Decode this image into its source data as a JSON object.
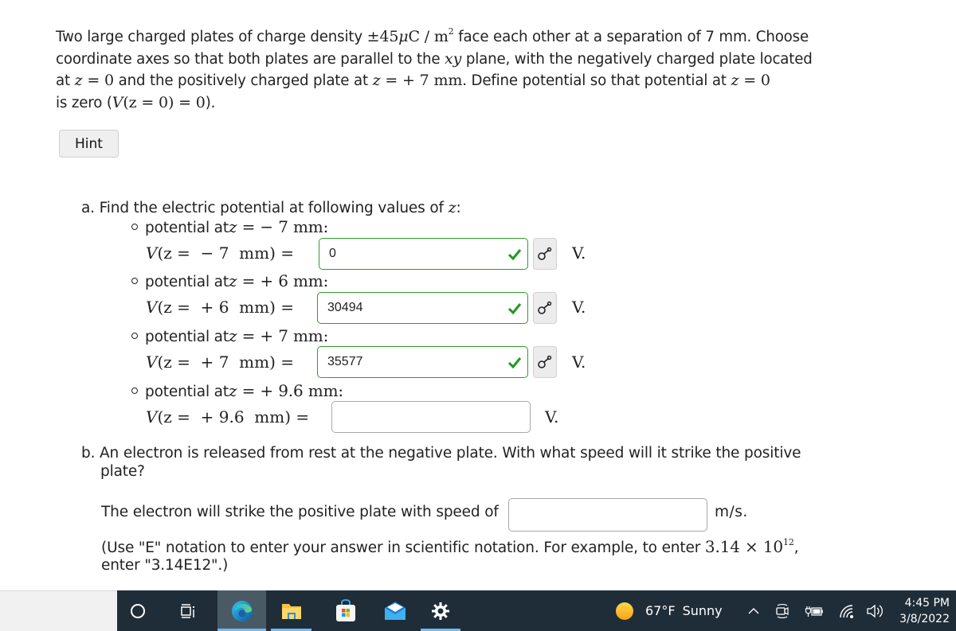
{
  "problem": {
    "line1_a": "Two large charged plates of charge density ",
    "charge_density": "±45",
    "mu": "μ",
    "unit_C": "C / m",
    "sup2": "2",
    "line1_b": " face each other at a separation of 7 mm. Choose",
    "line2_a": "coordinate axes so that both plates are parallel to the ",
    "xy": "xy",
    "line2_b": " plane, with the negatively charged plate located",
    "line3_a": "at ",
    "z": "z",
    "eq_zero": " = 0",
    "line3_b": " and the positively charged plate at ",
    "eq_plus7": " =  + 7  mm",
    "line3_c": ". Define potential so that potential at ",
    "line4_a": "is zero (",
    "V_expr": "V",
    "v0_expr": "(z = 0) = 0",
    "line4_b": ")."
  },
  "hint_button": {
    "label": "Hint"
  },
  "part_a": {
    "title": "a. Find the electric potential at following values of ",
    "title_var": "z",
    "title_end": ":",
    "items": [
      {
        "bullet_text": "potential at ",
        "bullet_math": " =  − 7  mm:",
        "eq_lhs": "(z =  − 7  mm) = ",
        "value": "0",
        "status": "correct",
        "unit": "V."
      },
      {
        "bullet_text": "potential at ",
        "bullet_math": " =  + 6  mm:",
        "eq_lhs": "(z =  + 6  mm) = ",
        "value": "30494",
        "status": "correct",
        "unit": "V."
      },
      {
        "bullet_text": "potential at ",
        "bullet_math": " =  + 7  mm:",
        "eq_lhs": "(z =  + 7  mm) = ",
        "value": "35577",
        "status": "correct",
        "unit": "V."
      },
      {
        "bullet_text": "potential at ",
        "bullet_math": " =  + 9.6  mm:",
        "eq_lhs": "(z =  + 9.6  mm) = ",
        "value": "",
        "status": "blank",
        "unit": "V."
      }
    ]
  },
  "part_b": {
    "question_line1": "b. An electron is released from rest at the negative plate. With what speed will it strike the positive",
    "question_line2": "plate?",
    "speed_prompt": "The electron will strike the positive plate with speed of",
    "speed_value": "",
    "speed_unit": "m/s.",
    "note_a": "(Use \"E\" notation to enter your answer in scientific notation. For example, to enter ",
    "note_math": "3.14 × 10",
    "note_exp": "12",
    "note_b": ",",
    "note_line2": "enter \"3.14E12\".)"
  },
  "taskbar": {
    "apps": [
      {
        "name": "cortana",
        "icon": "circle-icon"
      },
      {
        "name": "task-view",
        "icon": "task-view-icon"
      },
      {
        "name": "edge",
        "icon": "edge-icon",
        "active": true,
        "running": true
      },
      {
        "name": "file-explorer",
        "icon": "folder-icon",
        "running": true
      },
      {
        "name": "microsoft-store",
        "icon": "store-icon"
      },
      {
        "name": "mail",
        "icon": "mail-icon"
      },
      {
        "name": "settings",
        "icon": "gear-icon",
        "running": true
      }
    ],
    "weather": {
      "temp": "67°F",
      "condition": "Sunny",
      "icon": "sun-icon"
    },
    "time": "4:45 PM",
    "date": "3/8/2022"
  },
  "colors": {
    "correct_border": "#2c9e2c",
    "taskbar_bg": "#1f2d38",
    "running_indicator": "#76b9ed"
  }
}
